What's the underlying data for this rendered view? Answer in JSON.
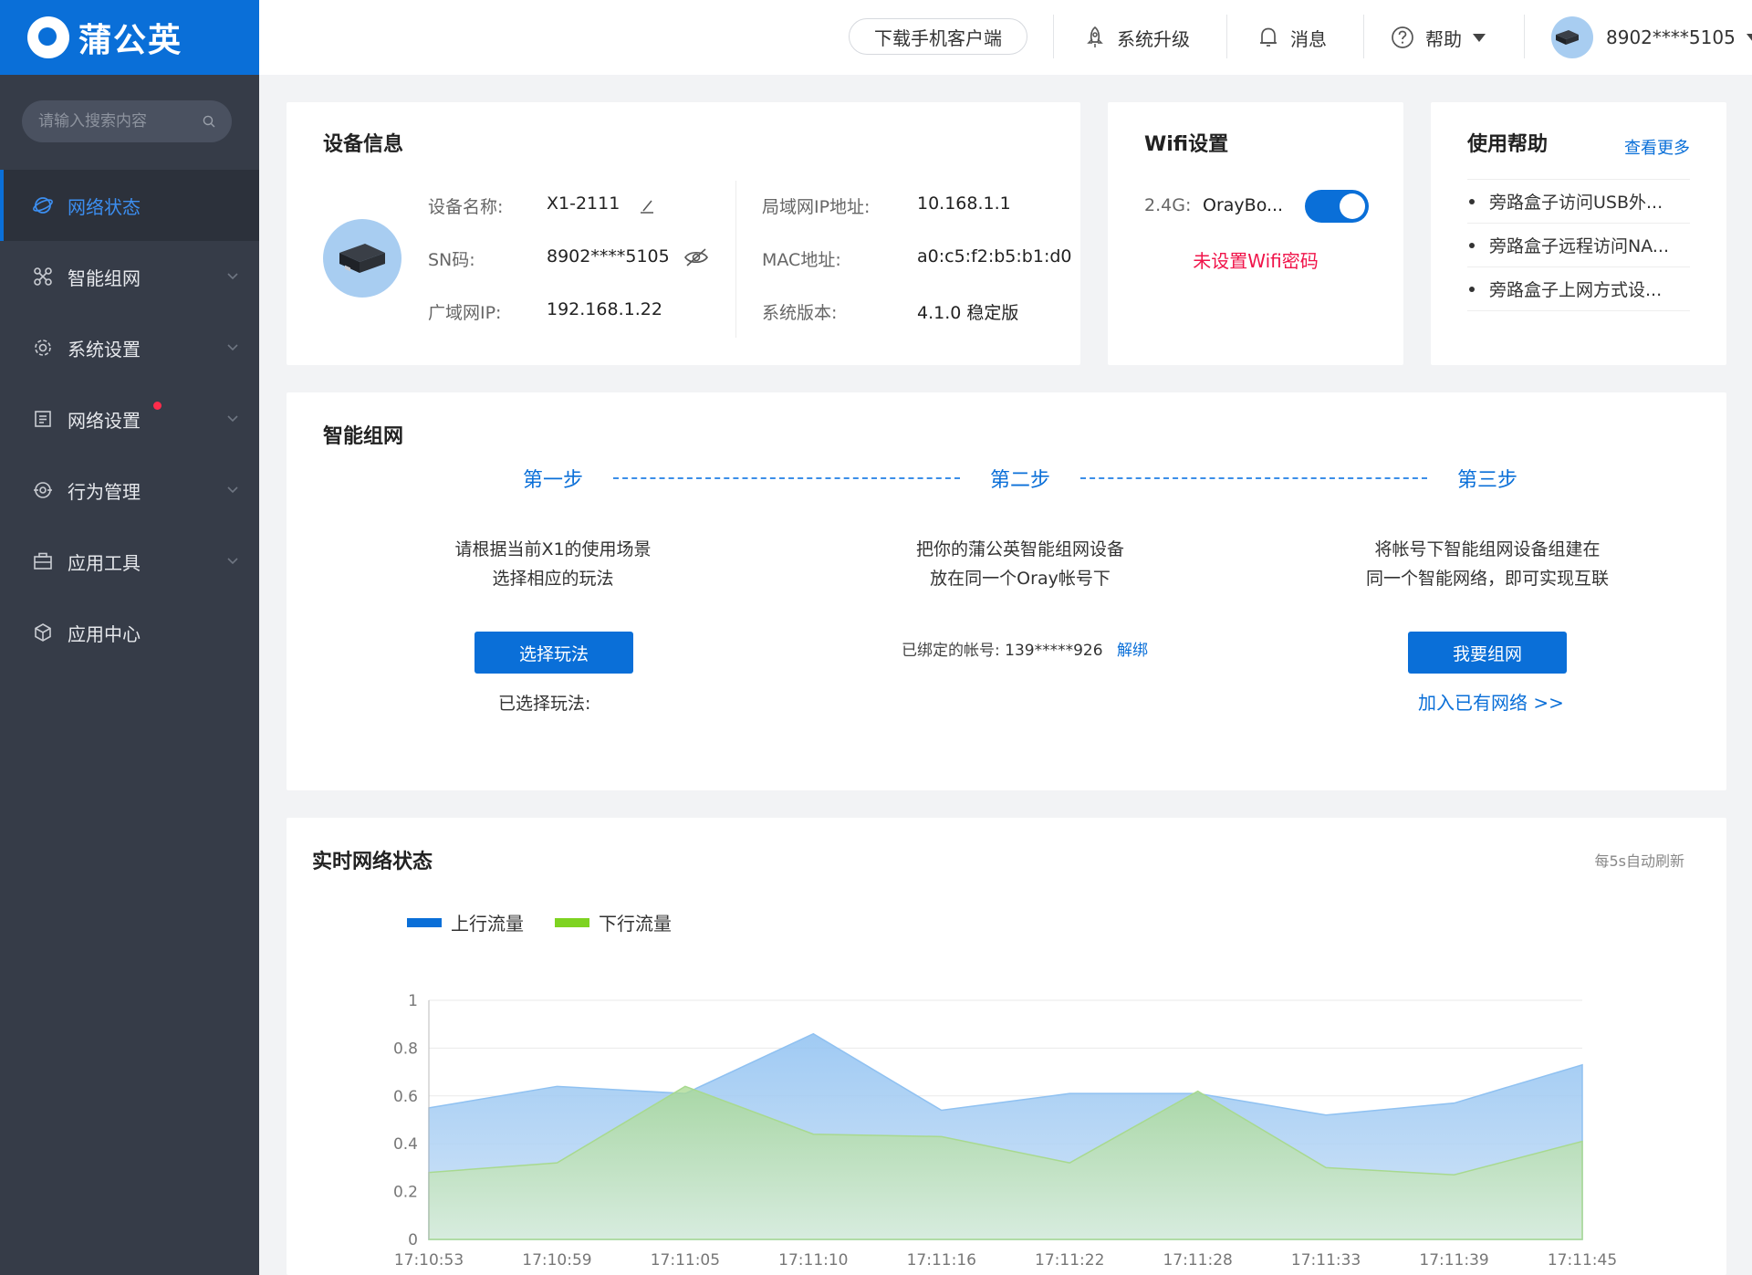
{
  "brand": {
    "name": "蒲公英",
    "color": "#0a6fd8"
  },
  "sidebar": {
    "search_placeholder": "请输入搜索内容",
    "items": [
      {
        "label": "网络状态",
        "icon": "globe-icon",
        "active": true
      },
      {
        "label": "智能组网",
        "icon": "network-icon",
        "expandable": true
      },
      {
        "label": "系统设置",
        "icon": "gear-icon",
        "expandable": true
      },
      {
        "label": "网络设置",
        "icon": "document-icon",
        "expandable": true,
        "badge_dot": true
      },
      {
        "label": "行为管理",
        "icon": "target-icon",
        "expandable": true
      },
      {
        "label": "应用工具",
        "icon": "toolbox-icon",
        "expandable": true
      },
      {
        "label": "应用中心",
        "icon": "cube-icon"
      }
    ]
  },
  "topbar": {
    "download": "下载手机客户端",
    "upgrade": "系统升级",
    "messages": "消息",
    "help": "帮助",
    "account": "8902****5105"
  },
  "device_info": {
    "title": "设备信息",
    "name_label": "设备名称:",
    "name_value": "X1-2111",
    "sn_label": "SN码:",
    "sn_value": "8902****5105",
    "wan_label": "广域网IP:",
    "wan_value": "192.168.1.22",
    "lan_label": "局域网IP地址:",
    "lan_value": "10.168.1.1",
    "mac_label": "MAC地址:",
    "mac_value": "a0:c5:f2:b5:b1:d0",
    "version_label": "系统版本:",
    "version_value": "4.1.0 稳定版"
  },
  "wifi": {
    "title": "Wifi设置",
    "band": "2.4G:",
    "ssid": "OrayBo...",
    "enabled": true,
    "warning": "未设置Wifi密码"
  },
  "help": {
    "title": "使用帮助",
    "more": "查看更多",
    "items": [
      "旁路盒子访问USB外...",
      "旁路盒子远程访问NA...",
      "旁路盒子上网方式设..."
    ]
  },
  "smart_network": {
    "title": "智能组网",
    "steps": [
      {
        "title": "第一步",
        "desc1": "请根据当前X1的使用场景",
        "desc2": "选择相应的玩法",
        "button": "选择玩法",
        "note": "已选择玩法:"
      },
      {
        "title": "第二步",
        "desc1": "把你的蒲公英智能组网设备",
        "desc2": "放在同一个Oray帐号下",
        "bound_label": "已绑定的帐号:",
        "bound_value": "139*****926",
        "unbind": "解绑"
      },
      {
        "title": "第三步",
        "desc1": "将帐号下智能组网设备组建在",
        "desc2": "同一个智能网络，即可实现互联",
        "button": "我要组网",
        "link": "加入已有网络 >>"
      }
    ]
  },
  "realtime": {
    "title": "实时网络状态",
    "refresh_note": "每5s自动刷新"
  },
  "chart_data": {
    "type": "area",
    "x": [
      "17:10:53",
      "17:10:59",
      "17:11:05",
      "17:11:10",
      "17:11:16",
      "17:11:22",
      "17:11:28",
      "17:11:33",
      "17:11:39",
      "17:11:45"
    ],
    "series": [
      {
        "name": "上行流量",
        "color": "#0a6fd8",
        "values": [
          0.55,
          0.64,
          0.61,
          0.86,
          0.54,
          0.61,
          0.61,
          0.52,
          0.57,
          0.73
        ]
      },
      {
        "name": "下行流量",
        "color": "#7ed321",
        "values": [
          0.28,
          0.32,
          0.64,
          0.44,
          0.43,
          0.32,
          0.62,
          0.3,
          0.27,
          0.41
        ]
      }
    ],
    "yticks": [
      "0",
      "0.2",
      "0.4",
      "0.6",
      "0.8",
      "1"
    ],
    "ylim": [
      0,
      1
    ],
    "grid": true,
    "legend": "top-left"
  }
}
